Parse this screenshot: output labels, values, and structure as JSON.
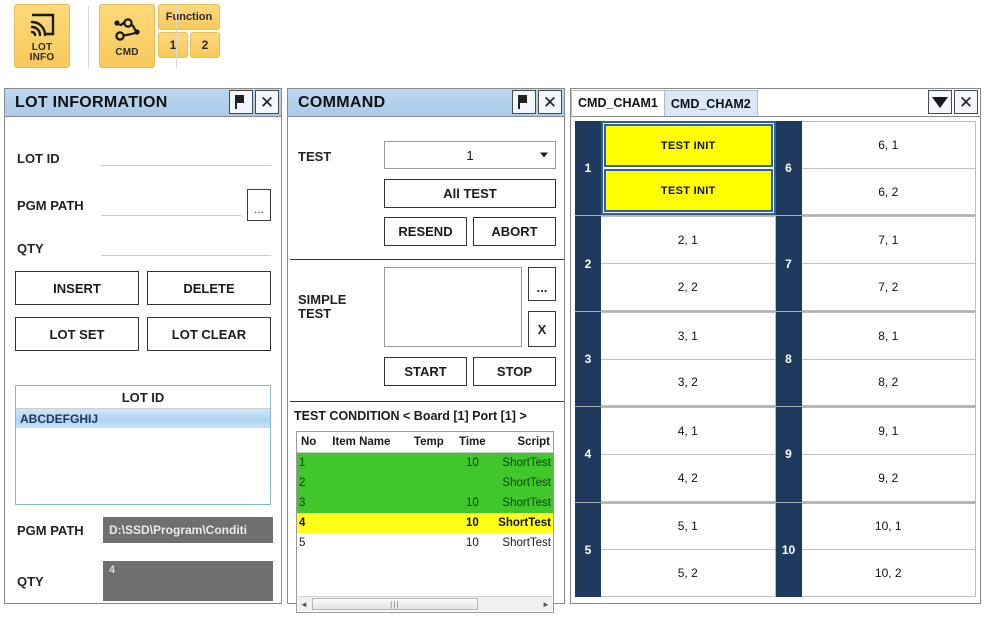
{
  "toolbar": {
    "lot_info": {
      "label_line1": "LOT",
      "label_line2": "INFO",
      "icon": "cast-screen-icon"
    },
    "cmd": {
      "label": "CMD",
      "icon": "node-graph-icon"
    },
    "function": {
      "label": "Function",
      "btn1": "1",
      "btn2": "2"
    }
  },
  "lot_information": {
    "title": "LOT INFORMATION",
    "pin_icon": "pin-icon",
    "close_icon": "close-icon",
    "fields": {
      "lot_id_label": "LOT ID",
      "lot_id_value": "",
      "pgm_path_label": "PGM PATH",
      "pgm_path_value": "",
      "browse_label": "...",
      "qty_label": "QTY",
      "qty_value": ""
    },
    "buttons": {
      "insert": "INSERT",
      "delete": "DELETE",
      "lot_set": "LOT SET",
      "lot_clear": "LOT CLEAR"
    },
    "list": {
      "header": "LOT ID",
      "rows": [
        "ABCDEFGHIJ"
      ]
    },
    "selected": {
      "pgm_path_label": "PGM PATH",
      "pgm_path_value": "D:\\SSD\\Program\\Conditi",
      "qty_label": "QTY",
      "qty_value": "4"
    }
  },
  "command": {
    "title": "COMMAND",
    "pin_icon": "pin-icon",
    "close_icon": "close-icon",
    "test_label": "TEST",
    "test_value": "1",
    "test_options": [
      "1"
    ],
    "all_test": "All TEST",
    "resend": "RESEND",
    "abort": "ABORT",
    "simple_test_label_line1": "SIMPLE",
    "simple_test_label_line2": "TEST",
    "simple_test_value": "",
    "browse_label": "...",
    "clear_label": "X",
    "start": "START",
    "stop": "STOP",
    "condition_title": "TEST CONDITION < Board [1] Port [1] >",
    "table": {
      "columns": [
        "No",
        "Item Name",
        "Temp",
        "Time",
        "Script"
      ],
      "rows": [
        {
          "no": "1",
          "item": "",
          "temp": "",
          "time": "10",
          "script": "ShortTest",
          "state": "green"
        },
        {
          "no": "2",
          "item": "",
          "temp": "",
          "time": "",
          "script": "ShortTest",
          "state": "green"
        },
        {
          "no": "3",
          "item": "",
          "temp": "",
          "time": "10",
          "script": "ShortTest",
          "state": "green"
        },
        {
          "no": "4",
          "item": "",
          "temp": "",
          "time": "10",
          "script": "ShortTest",
          "state": "yellow"
        },
        {
          "no": "5",
          "item": "",
          "temp": "",
          "time": "10",
          "script": "ShortTest",
          "state": "plain"
        }
      ]
    },
    "scroll_left": "◄",
    "scroll_right": "►",
    "scroll_grip": "|||"
  },
  "chamber": {
    "tabs": [
      {
        "label": "CMD_CHAM1",
        "active": true
      },
      {
        "label": "CMD_CHAM2",
        "active": false
      }
    ],
    "dropdown_icon": "triangle-down-icon",
    "close_icon": "close-icon",
    "left_groups": [
      {
        "index": "1",
        "cells": [
          {
            "text": "TEST INIT",
            "state": "active"
          },
          {
            "text": "TEST INIT",
            "state": "active"
          }
        ]
      },
      {
        "index": "2",
        "cells": [
          {
            "text": "2, 1",
            "state": "idle"
          },
          {
            "text": "2, 2",
            "state": "idle"
          }
        ]
      },
      {
        "index": "3",
        "cells": [
          {
            "text": "3, 1",
            "state": "idle"
          },
          {
            "text": "3, 2",
            "state": "idle"
          }
        ]
      },
      {
        "index": "4",
        "cells": [
          {
            "text": "4, 1",
            "state": "idle"
          },
          {
            "text": "4, 2",
            "state": "idle"
          }
        ]
      },
      {
        "index": "5",
        "cells": [
          {
            "text": "5, 1",
            "state": "idle"
          },
          {
            "text": "5, 2",
            "state": "idle"
          }
        ]
      }
    ],
    "right_groups": [
      {
        "index": "6",
        "cells": [
          {
            "text": "6, 1",
            "state": "idle"
          },
          {
            "text": "6, 2",
            "state": "idle"
          }
        ]
      },
      {
        "index": "7",
        "cells": [
          {
            "text": "7, 1",
            "state": "idle"
          },
          {
            "text": "7, 2",
            "state": "idle"
          }
        ]
      },
      {
        "index": "8",
        "cells": [
          {
            "text": "8, 1",
            "state": "idle"
          },
          {
            "text": "8, 2",
            "state": "idle"
          }
        ]
      },
      {
        "index": "9",
        "cells": [
          {
            "text": "9, 1",
            "state": "idle"
          },
          {
            "text": "9, 2",
            "state": "idle"
          }
        ]
      },
      {
        "index": "10",
        "cells": [
          {
            "text": "10, 1",
            "state": "idle"
          },
          {
            "text": "10, 2",
            "state": "idle"
          }
        ]
      }
    ]
  },
  "colors": {
    "accent_yellow": "#ffff00",
    "toolbar_gold": "#f8c95c",
    "title_blue": "#a9cbe9",
    "chamber_navy": "#1f3a5f",
    "row_green": "#3fc72b",
    "row_yellow": "#ffff1a",
    "gray_field": "#6f6f6f"
  }
}
